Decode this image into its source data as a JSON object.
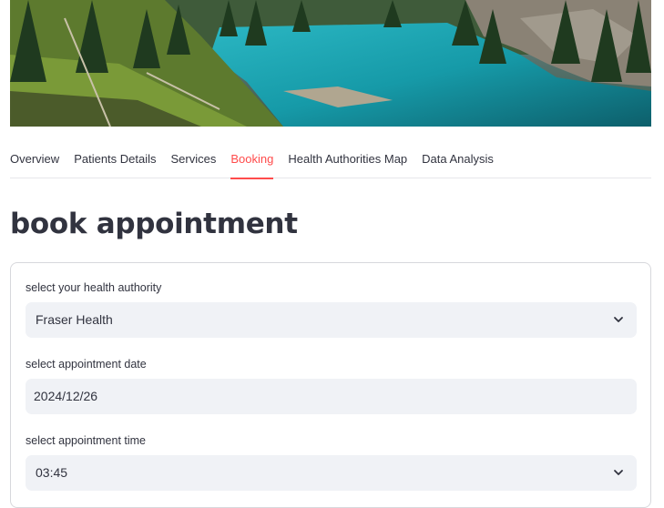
{
  "tabs": [
    {
      "label": "Overview"
    },
    {
      "label": "Patients Details"
    },
    {
      "label": "Services"
    },
    {
      "label": "Booking"
    },
    {
      "label": "Health Authorities Map"
    },
    {
      "label": "Data Analysis"
    }
  ],
  "active_tab": "Booking",
  "colors": {
    "accent": "#ff4b4b",
    "field_bg": "#f0f2f6",
    "text": "#31333f"
  },
  "page_title": "book appointment",
  "form": {
    "authority": {
      "label": "select your health authority",
      "value": "Fraser Health"
    },
    "date": {
      "label": "select appointment date",
      "value": "2024/12/26"
    },
    "time": {
      "label": "select appointment time",
      "value": "03:45"
    }
  }
}
